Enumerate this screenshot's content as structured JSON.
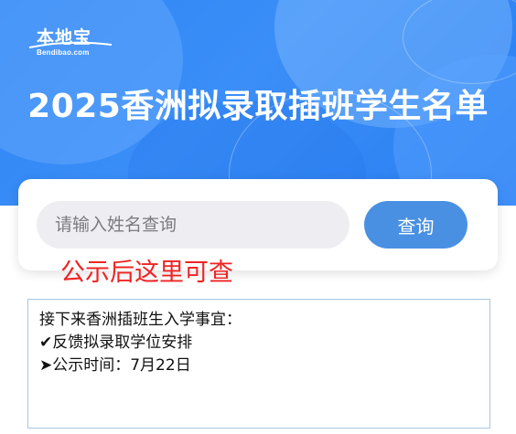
{
  "banner": {
    "logo_main": "本地宝",
    "logo_sub": "Bendibao.com",
    "title": "2025香洲拟录取插班学生名单"
  },
  "search": {
    "placeholder": "请输入姓名查询",
    "value": "",
    "button_label": "查询"
  },
  "notice": "公示后这里可查",
  "info": {
    "heading": "接下来香洲插班生入学事宜：",
    "items": [
      "✔反馈拟录取学位安排",
      "➤公示时间：7月22日"
    ]
  },
  "colors": {
    "banner": "#2f86f5",
    "button": "#4a90e2",
    "notice": "#ee2424",
    "input_bg": "#eeeef2",
    "box_border": "#a8c6e6"
  }
}
